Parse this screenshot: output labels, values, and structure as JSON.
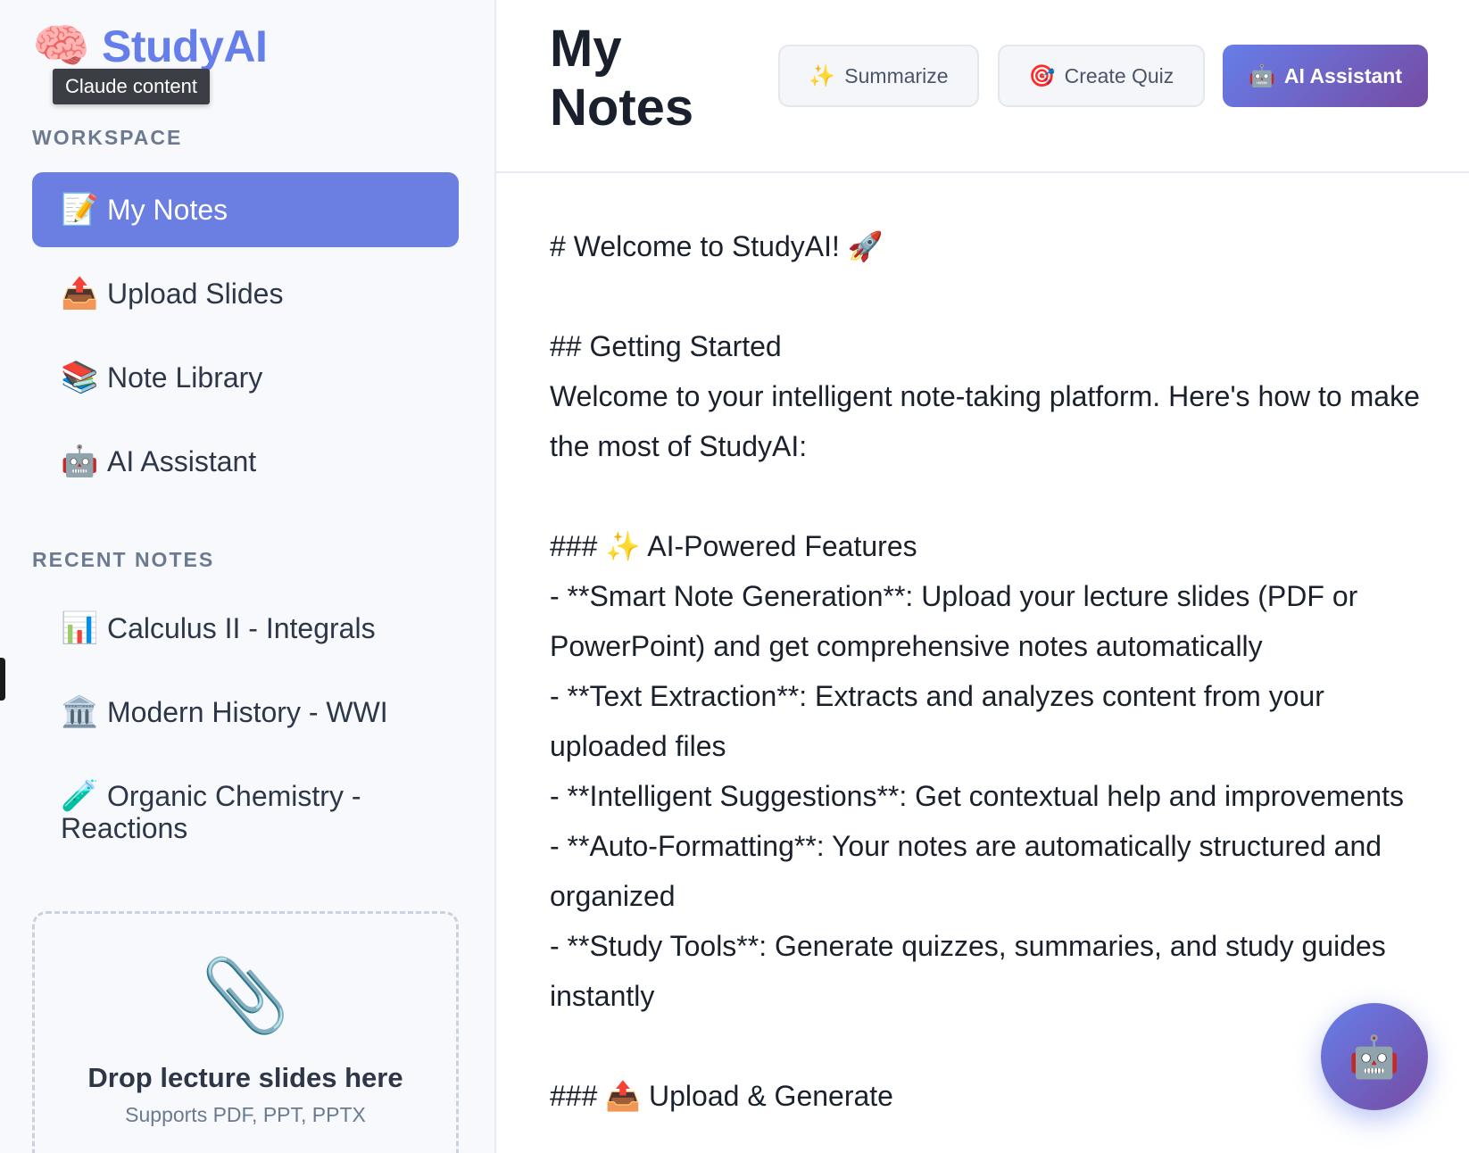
{
  "brand": {
    "icon": "🧠",
    "name": "StudyAI"
  },
  "tooltip": "Claude content",
  "sidebar": {
    "workspace_label": "WORKSPACE",
    "items": [
      {
        "icon": "📝",
        "label": "My Notes",
        "active": true
      },
      {
        "icon": "📤",
        "label": "Upload Slides"
      },
      {
        "icon": "📚",
        "label": "Note Library"
      },
      {
        "icon": "🤖",
        "label": "AI Assistant"
      }
    ],
    "recent_label": "RECENT NOTES",
    "recent": [
      {
        "icon": "📊",
        "label": "Calculus II - Integrals"
      },
      {
        "icon": "🏛️",
        "label": "Modern History - WWI"
      },
      {
        "icon": "🧪",
        "label": "Organic Chemistry - Reactions"
      }
    ],
    "dropzone": {
      "icon": "📎",
      "title": "Drop lecture slides here",
      "subtitle": "Supports PDF, PPT, PPTX"
    }
  },
  "header": {
    "title": "My Notes",
    "buttons": {
      "summarize": {
        "icon": "✨",
        "label": "Summarize"
      },
      "quiz": {
        "icon": "🎯",
        "label": "Create Quiz"
      },
      "ai": {
        "icon": "🤖",
        "label": "AI Assistant"
      }
    }
  },
  "content": {
    "lines": [
      "# Welcome to StudyAI! 🚀",
      "",
      "## Getting Started",
      "Welcome to your intelligent note-taking platform. Here's how to make the most of StudyAI:",
      "",
      "### ✨ AI-Powered Features",
      "- **Smart Note Generation**: Upload your lecture slides (PDF or PowerPoint) and get comprehensive notes automatically",
      "- **Text Extraction**: Extracts and analyzes content from your uploaded files",
      "- **Intelligent Suggestions**: Get contextual help and improvements",
      "- **Auto-Formatting**: Your notes are automatically structured and organized",
      "- **Study Tools**: Generate quizzes, summaries, and study guides instantly",
      "",
      "### 📤 Upload & Generate"
    ]
  },
  "fab": {
    "icon": "🤖"
  },
  "colors": {
    "accent": "#667eea",
    "accent_end": "#764ba2",
    "active_nav": "#6b7fe3"
  }
}
